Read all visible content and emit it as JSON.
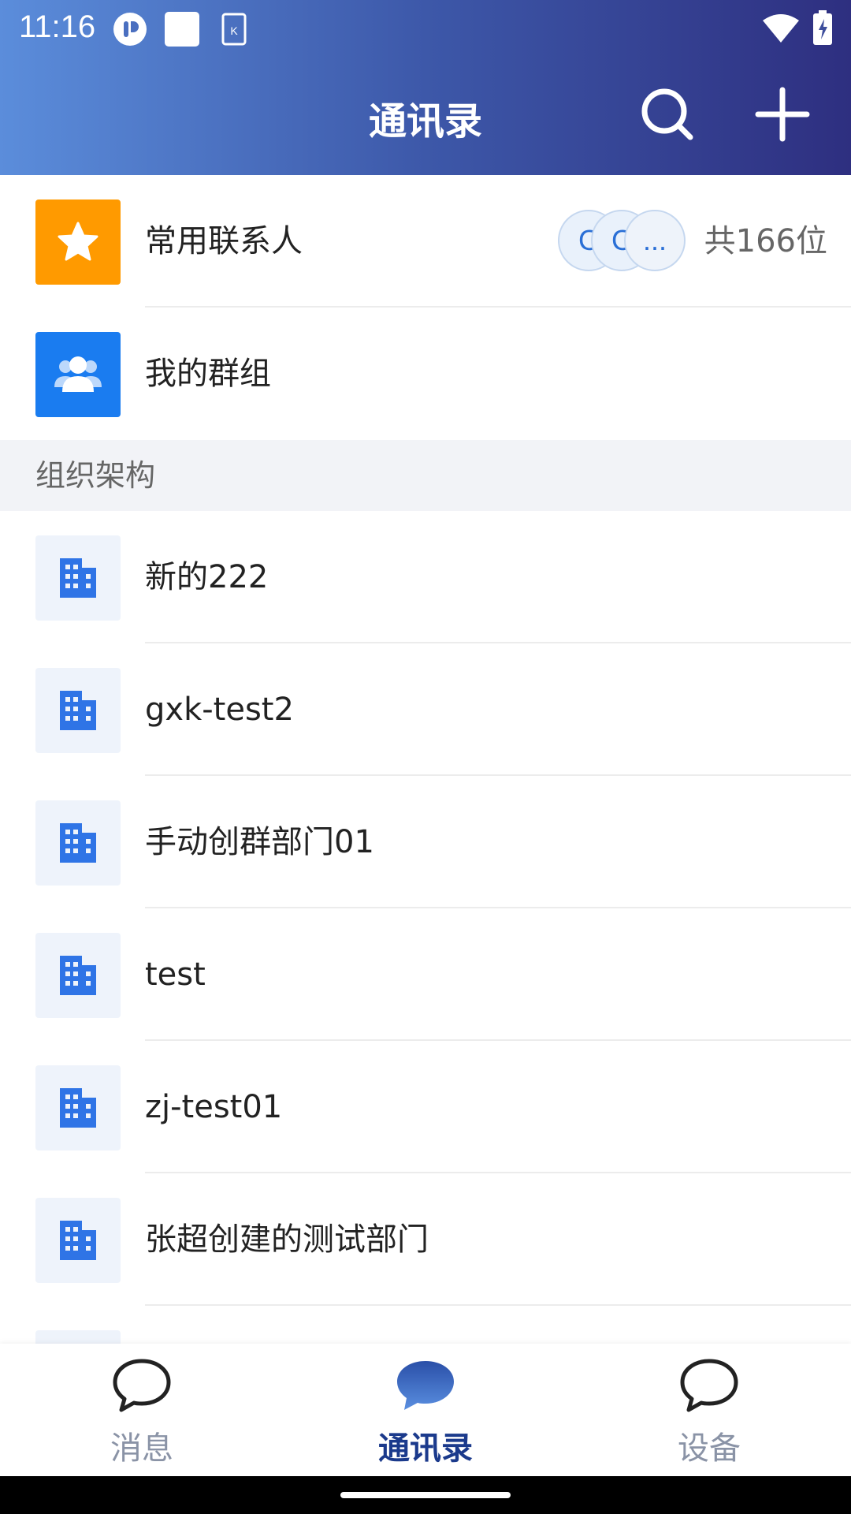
{
  "status_bar": {
    "time": "11:16"
  },
  "header": {
    "title": "通讯录"
  },
  "quick": [
    {
      "label": "常用联系人",
      "color": "#ff9a00",
      "icon": "star-icon"
    },
    {
      "label": "我的群组",
      "color": "#1a7cf0",
      "icon": "group-icon"
    }
  ],
  "favorites": {
    "avatars": [
      "C",
      "C",
      "..."
    ],
    "count": "共166位"
  },
  "section_title": "组织架构",
  "departments": [
    "新的222",
    "gxk-test2",
    "手动创群部门01",
    "test",
    "zj-test01",
    "张超创建的测试部门"
  ],
  "tabs": [
    {
      "label": "消息",
      "active": false
    },
    {
      "label": "通讯录",
      "active": true
    },
    {
      "label": "设备",
      "active": false
    }
  ],
  "colors": {
    "accent": "#1b3a8c",
    "dept_icon": "#2f74e6",
    "dept_icon_bg": "#eef3fb"
  }
}
